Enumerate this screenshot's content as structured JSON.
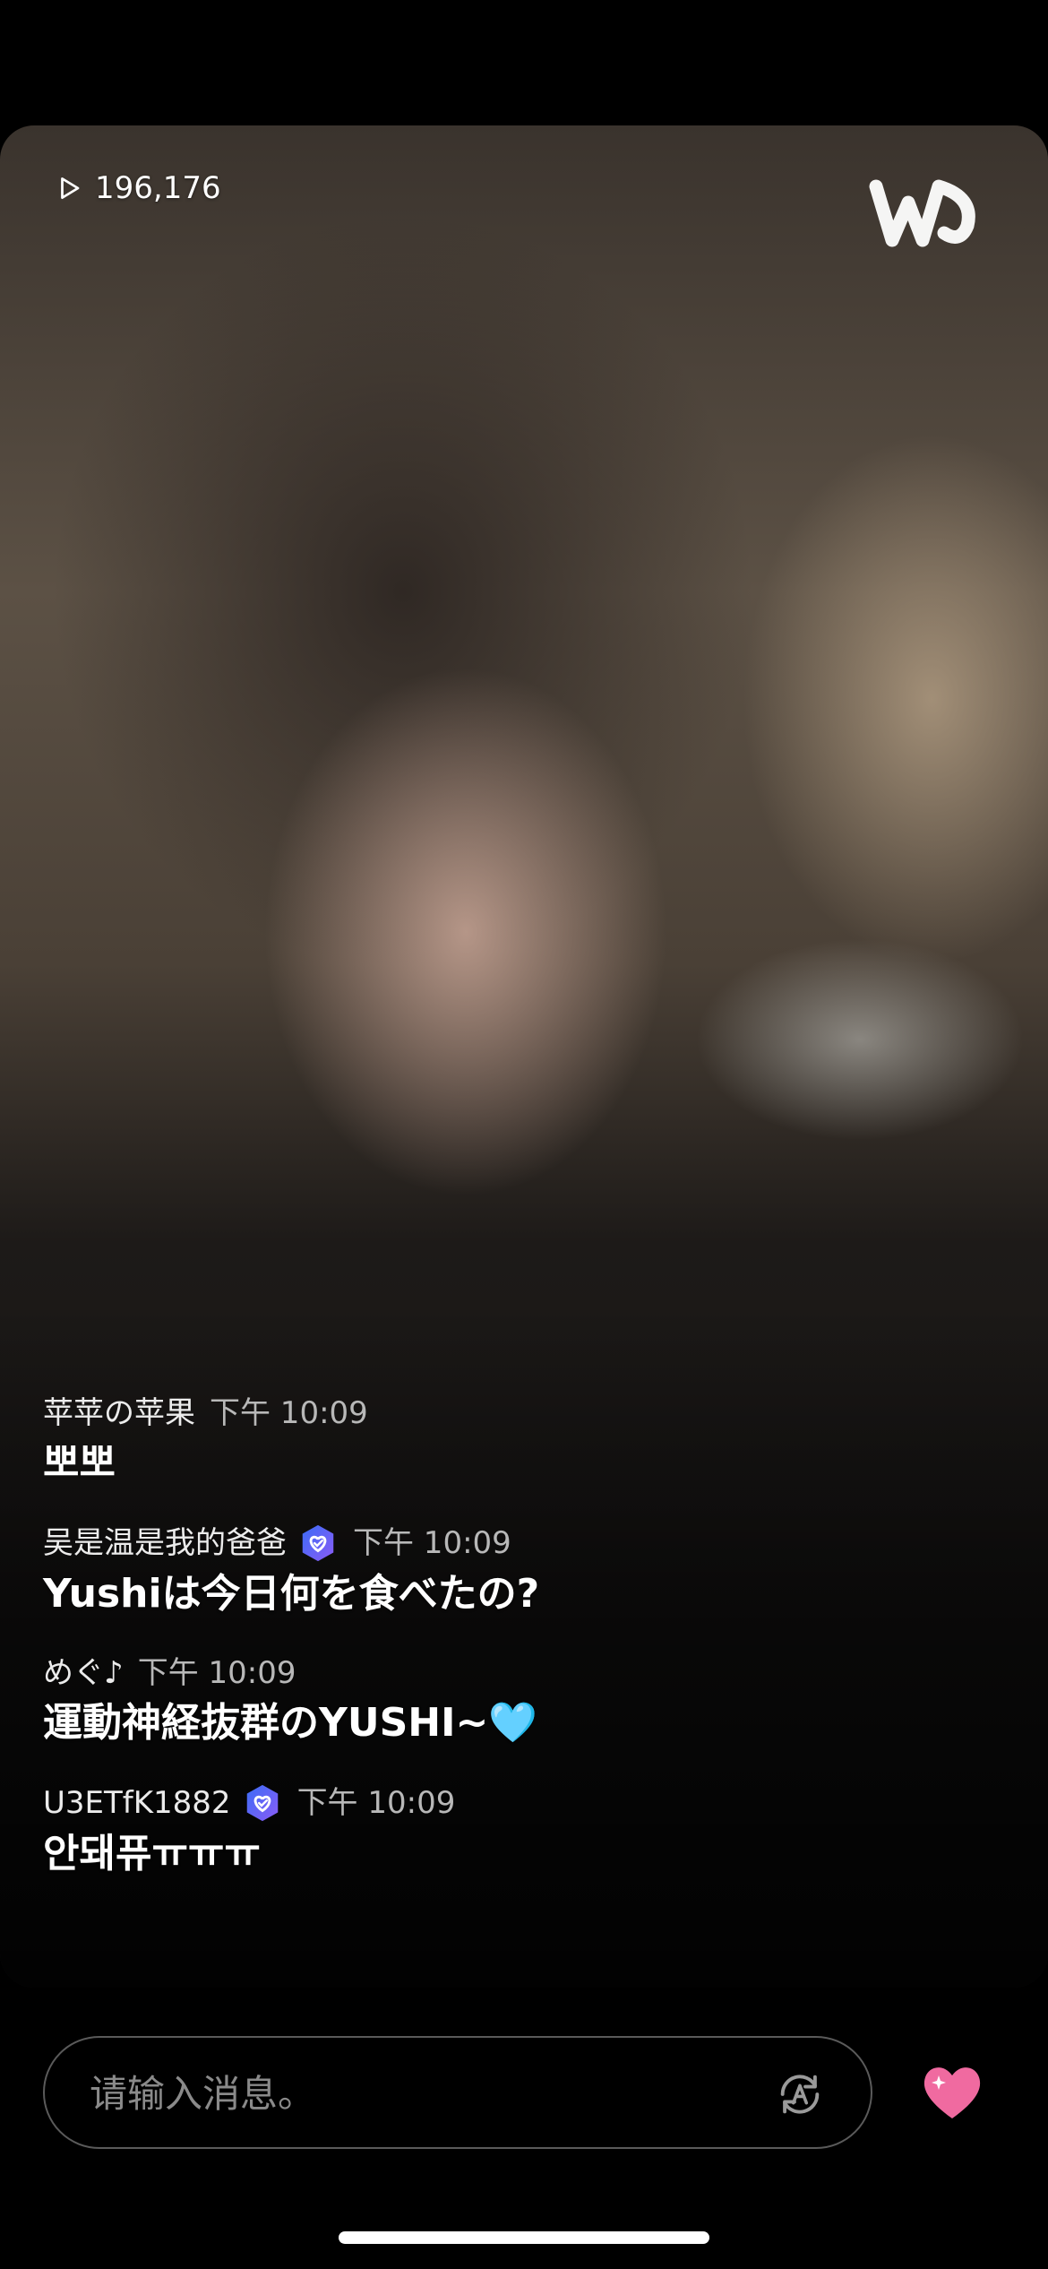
{
  "stream": {
    "view_count": "196,176",
    "view_icon": "play-icon",
    "logo_icon": "weverse-logo"
  },
  "chat": {
    "messages": [
      {
        "user": "苹苹の苹果",
        "time": "下午 10:09",
        "verified": false,
        "text": "뽀뽀"
      },
      {
        "user": "吴是温是我的爸爸",
        "time": "下午 10:09",
        "verified": true,
        "text": "Yushiは今日何を食べたの?"
      },
      {
        "user": "めぐ♪",
        "time": "下午 10:09",
        "verified": false,
        "text": "運動神経抜群のYUSHI~🩵"
      },
      {
        "user": "U3ETfK1882",
        "time": "下午 10:09",
        "verified": true,
        "text": "안돼퓨ㅠㅠㅠ"
      }
    ]
  },
  "input": {
    "placeholder": "请输入消息。",
    "translate_icon": "translate-icon",
    "heart_icon": "heart-icon"
  },
  "colors": {
    "badge_gradient_start": "#3b6cf6",
    "badge_gradient_end": "#8a5cf6",
    "heart": "#f06aa0",
    "background": "#000000"
  }
}
